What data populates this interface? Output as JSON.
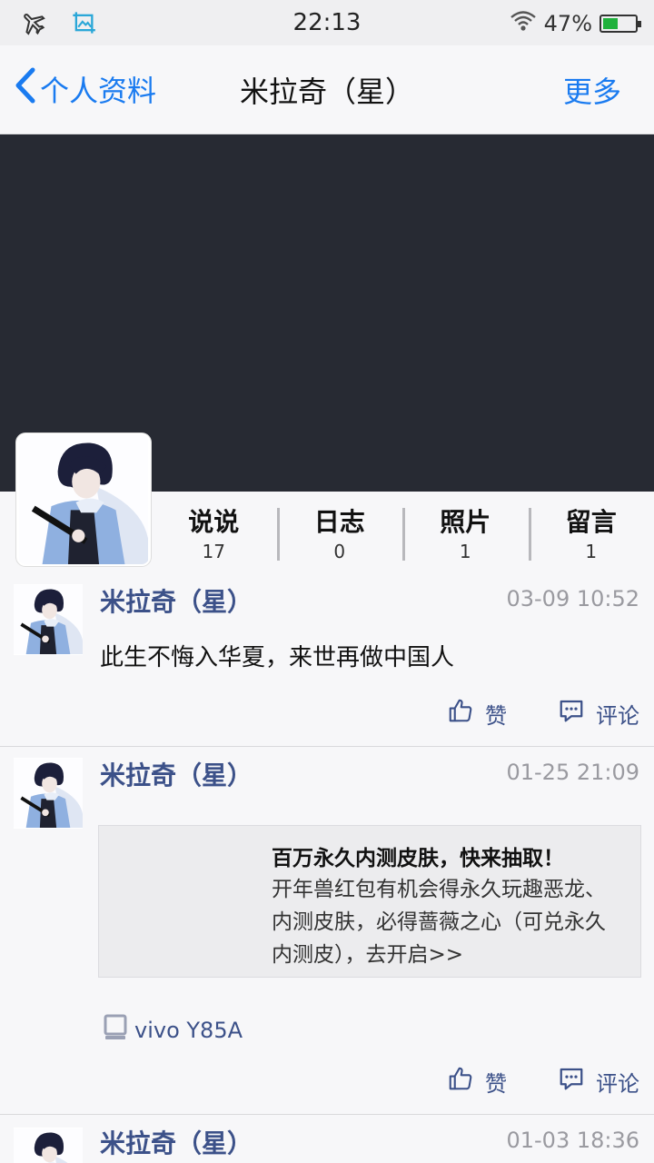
{
  "status_bar": {
    "time": "22:13",
    "battery_percent": "47%",
    "battery_level": 0.47,
    "icons": [
      "airplane-icon",
      "screenshot-icon",
      "wifi-icon",
      "battery-icon"
    ]
  },
  "nav": {
    "back_label": "个人资料",
    "title": "米拉奇（星）",
    "more_label": "更多"
  },
  "stats": [
    {
      "label": "说说",
      "count": "17"
    },
    {
      "label": "日志",
      "count": "0"
    },
    {
      "label": "照片",
      "count": "1"
    },
    {
      "label": "留言",
      "count": "1"
    }
  ],
  "posts": [
    {
      "name": "米拉奇（星）",
      "time": "03-09 10:52",
      "text": "此生不悔入华夏，来世再做中国人",
      "like_label": "赞",
      "comment_label": "评论"
    },
    {
      "name": "米拉奇（星）",
      "time": "01-25 21:09",
      "share_title": "百万永久内测皮肤，快来抽取！",
      "share_desc": "开年兽红包有机会得永久玩趣恶龙、内测皮肤，必得蔷薇之心（可兑永久内测皮），去开启>>",
      "device": "vivo Y85A",
      "like_label": "赞",
      "comment_label": "评论"
    },
    {
      "name": "米拉奇（星）",
      "time": "01-03 18:36"
    }
  ],
  "colors": {
    "accent_blue": "#1a7bf0",
    "name_blue": "#3c5189",
    "cover_bg": "#272a33",
    "battery_green": "#1fb13c"
  }
}
